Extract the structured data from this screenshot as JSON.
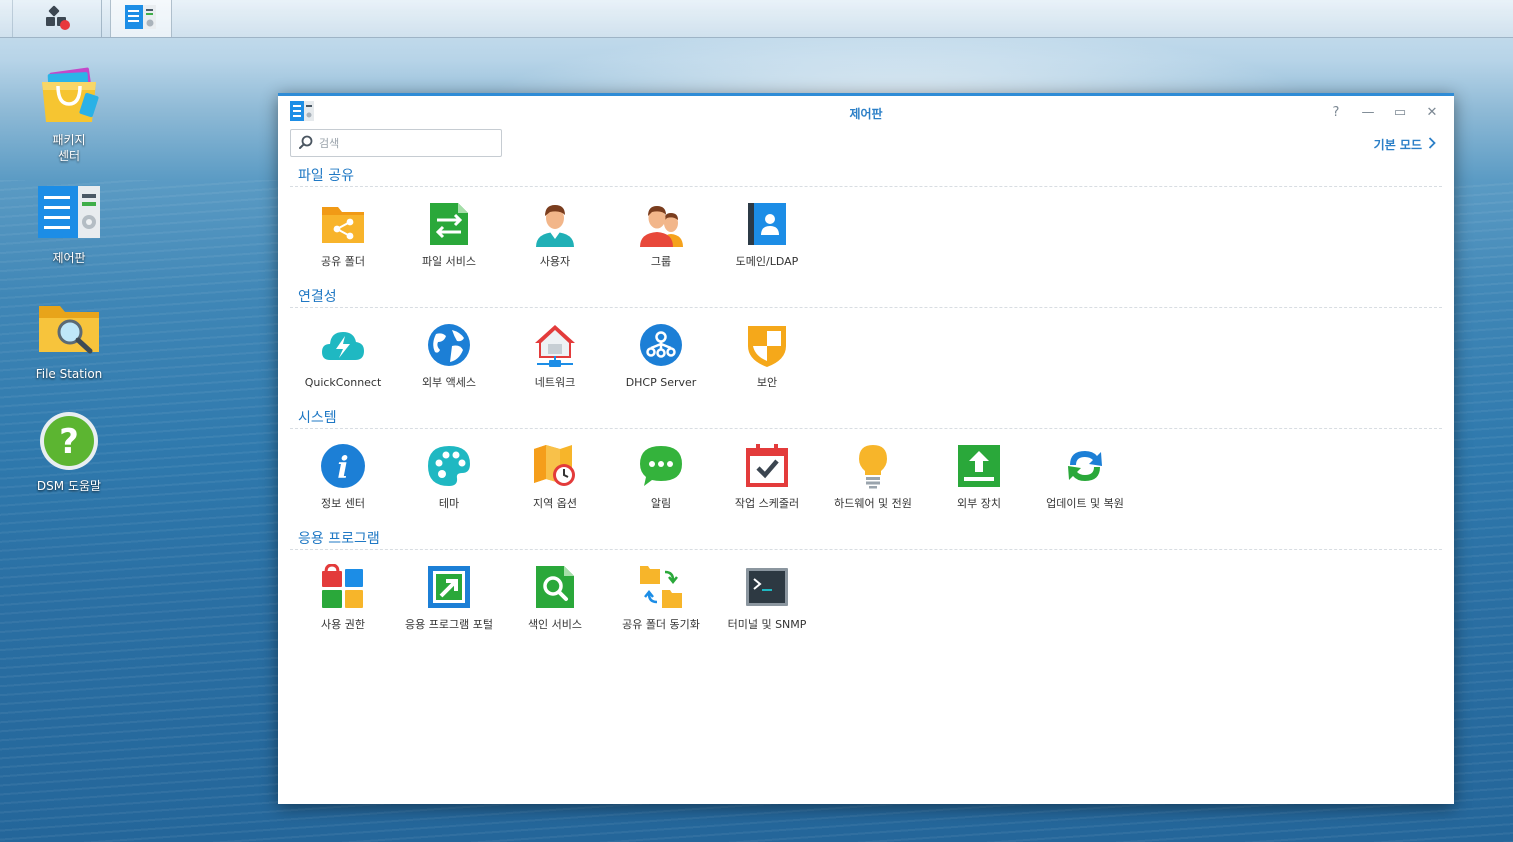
{
  "taskbar": {
    "main_menu_icon": "main-menu-icon",
    "open_app_icon": "control-panel-icon"
  },
  "desktop": {
    "icons": [
      {
        "label": "패키지\n센터",
        "icon": "package-center-icon"
      },
      {
        "label": "제어판",
        "icon": "control-panel-icon"
      },
      {
        "label": "File Station",
        "icon": "file-station-icon"
      },
      {
        "label": "DSM 도움말",
        "icon": "help-icon"
      }
    ]
  },
  "window": {
    "title": "제어판",
    "controls": {
      "help": "?",
      "minimize": "—",
      "maximize": "▭",
      "close": "✕"
    },
    "search_placeholder": "검색",
    "basic_mode_label": "기본 모드",
    "sections": [
      {
        "title": "파일 공유",
        "items": [
          {
            "label": "공유 폴더",
            "icon": "shared-folder-icon"
          },
          {
            "label": "파일 서비스",
            "icon": "file-services-icon"
          },
          {
            "label": "사용자",
            "icon": "user-icon"
          },
          {
            "label": "그룹",
            "icon": "group-icon"
          },
          {
            "label": "도메인/LDAP",
            "icon": "domain-ldap-icon"
          }
        ]
      },
      {
        "title": "연결성",
        "items": [
          {
            "label": "QuickConnect",
            "icon": "quickconnect-icon"
          },
          {
            "label": "외부 액세스",
            "icon": "external-access-icon"
          },
          {
            "label": "네트워크",
            "icon": "network-icon"
          },
          {
            "label": "DHCP Server",
            "icon": "dhcp-server-icon"
          },
          {
            "label": "보안",
            "icon": "security-icon"
          }
        ]
      },
      {
        "title": "시스템",
        "items": [
          {
            "label": "정보 센터",
            "icon": "info-center-icon"
          },
          {
            "label": "테마",
            "icon": "theme-icon"
          },
          {
            "label": "지역 옵션",
            "icon": "regional-options-icon"
          },
          {
            "label": "알림",
            "icon": "notification-icon"
          },
          {
            "label": "작업 스케줄러",
            "icon": "task-scheduler-icon"
          },
          {
            "label": "하드웨어 및 전원",
            "icon": "hardware-power-icon"
          },
          {
            "label": "외부 장치",
            "icon": "external-devices-icon"
          },
          {
            "label": "업데이트 및 복원",
            "icon": "update-restore-icon"
          }
        ]
      },
      {
        "title": "응용 프로그램",
        "items": [
          {
            "label": "사용 권한",
            "icon": "privileges-icon"
          },
          {
            "label": "응용 프로그램 포털",
            "icon": "application-portal-icon"
          },
          {
            "label": "색인 서비스",
            "icon": "indexing-service-icon"
          },
          {
            "label": "공유 폴더 동기화",
            "icon": "shared-folder-sync-icon"
          },
          {
            "label": "터미널 및 SNMP",
            "icon": "terminal-snmp-icon"
          }
        ]
      }
    ]
  }
}
